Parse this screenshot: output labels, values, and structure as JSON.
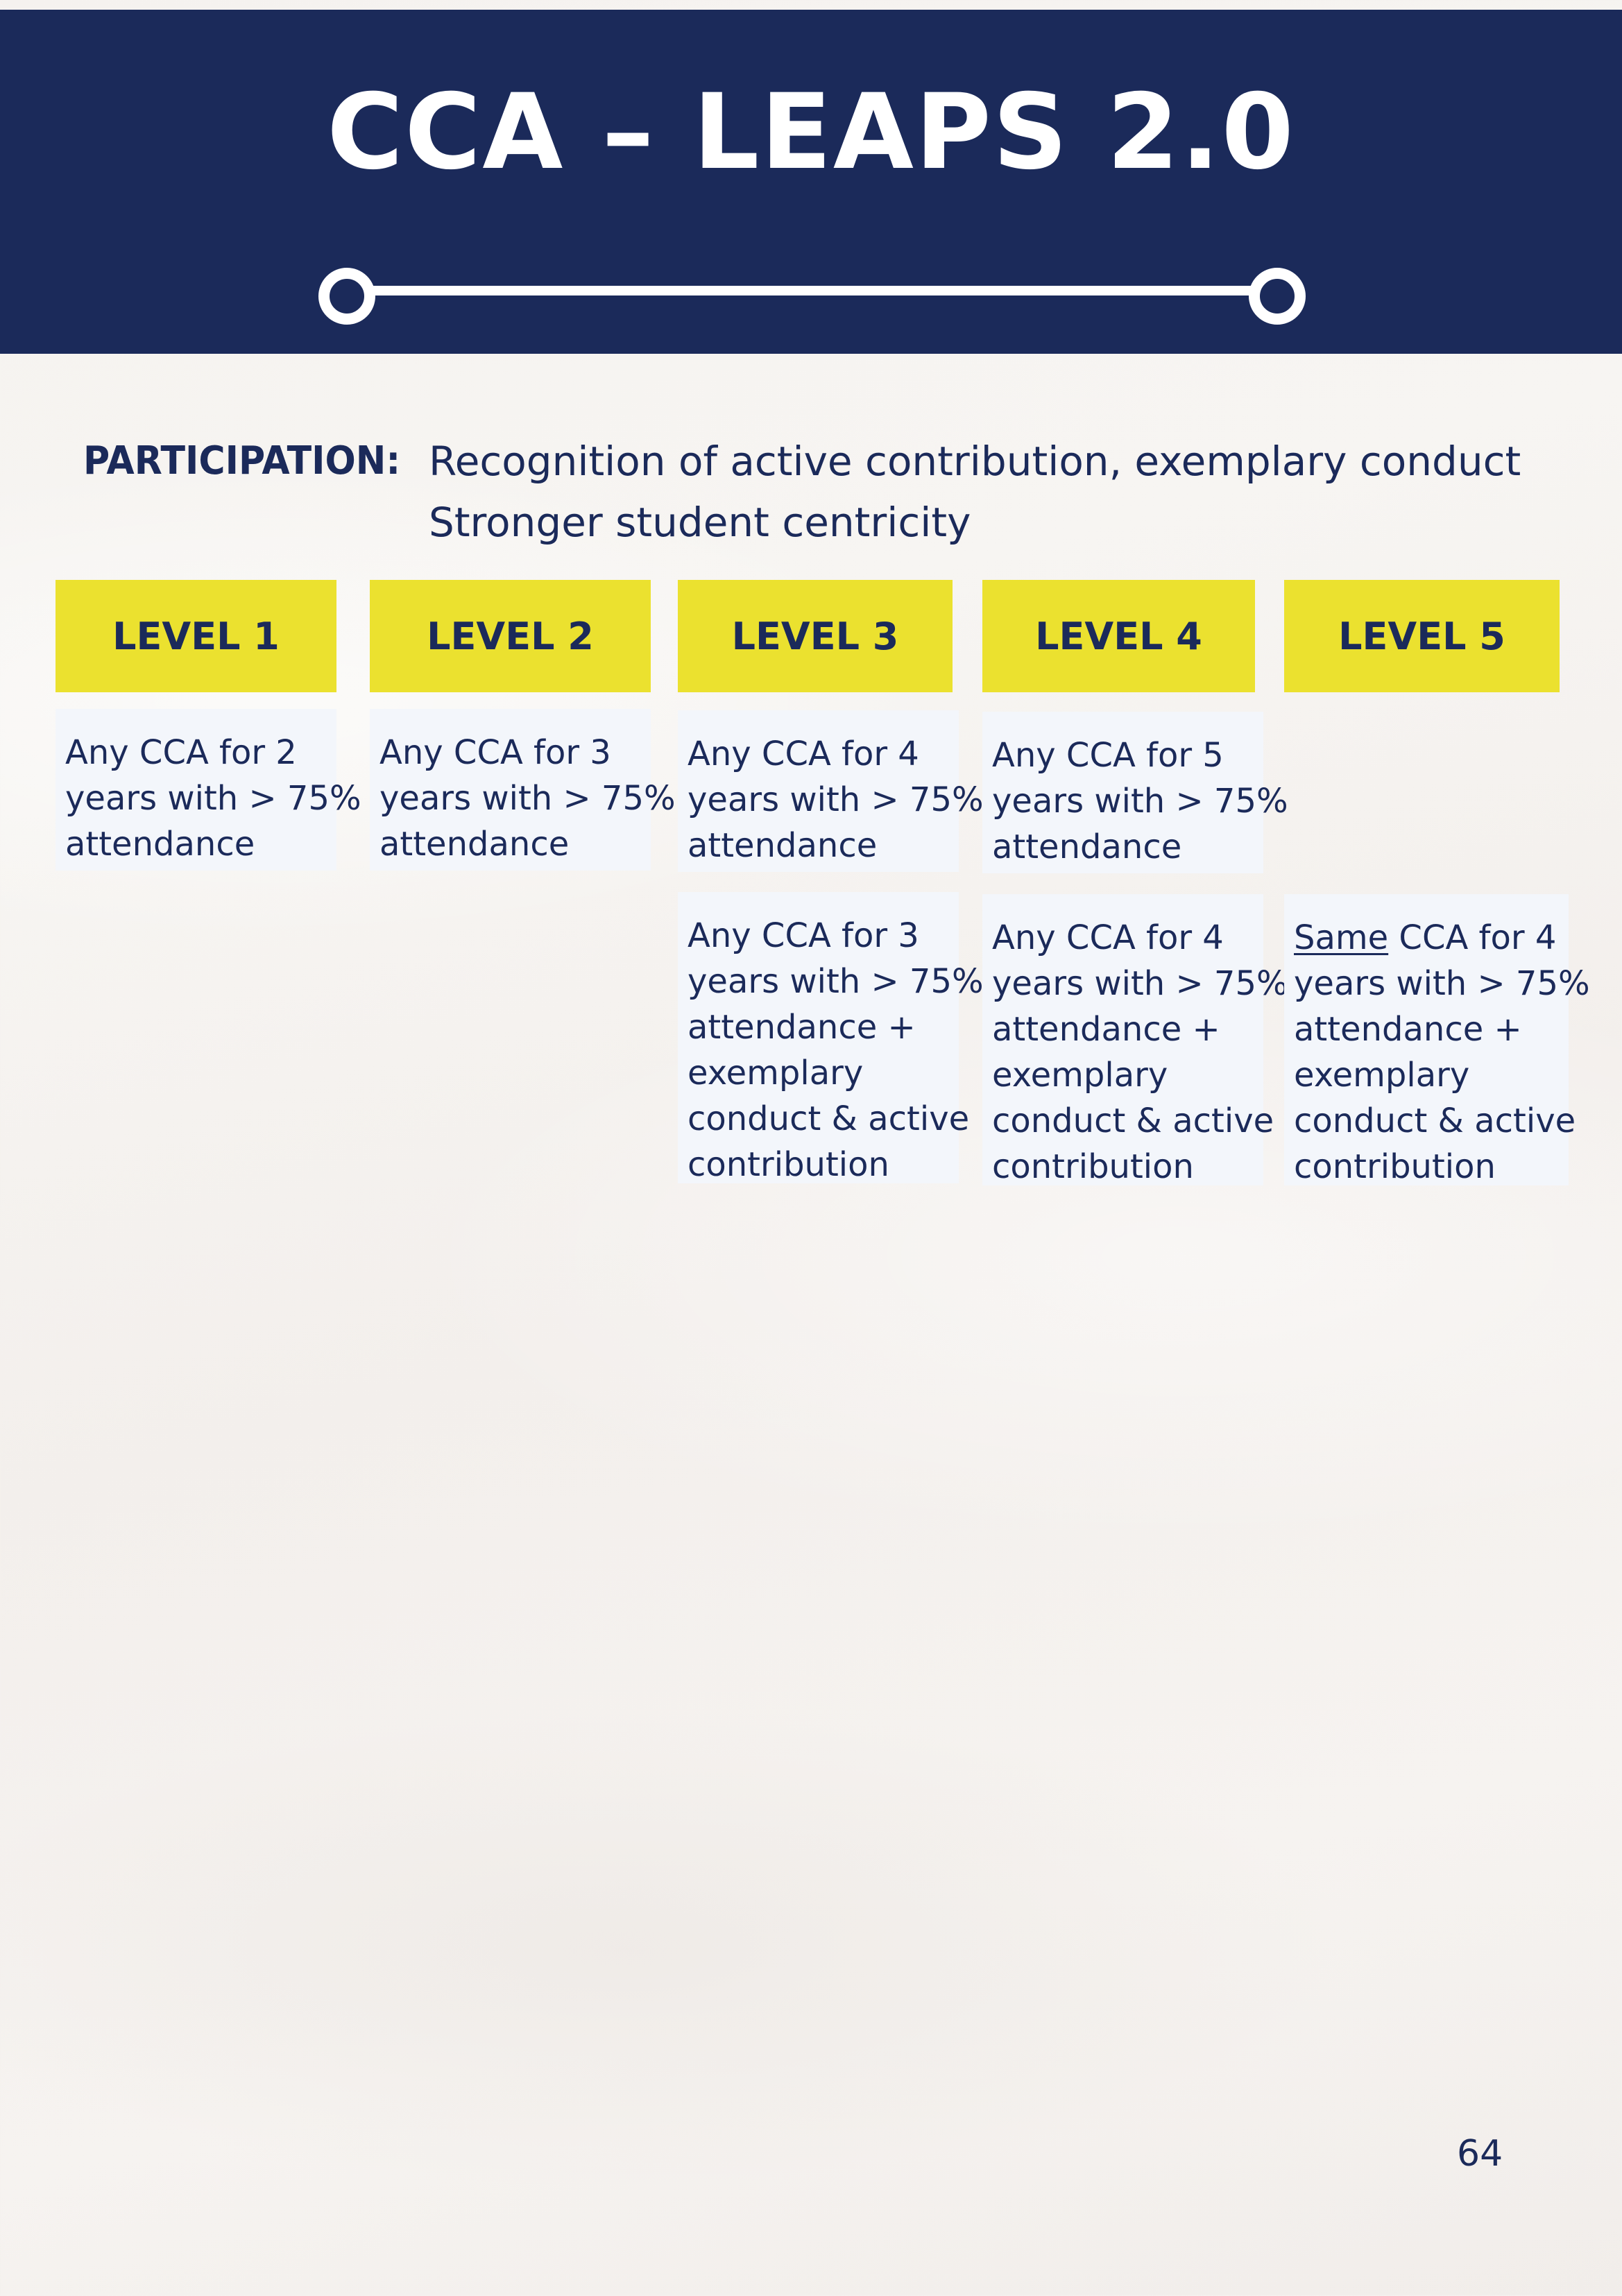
{
  "header": {
    "title": "CCA – LEAPS 2.0",
    "background_color": "#1b2a5a",
    "icon": "timeline-connector-icon"
  },
  "participation": {
    "label": "PARTICIPATION:",
    "line1": "Recognition of active contribution, exemplary conduct",
    "line2": "Stronger student centricity"
  },
  "levels": [
    {
      "label": "LEVEL 1"
    },
    {
      "label": "LEVEL 2"
    },
    {
      "label": "LEVEL 3"
    },
    {
      "label": "LEVEL 4"
    },
    {
      "label": "LEVEL 5"
    }
  ],
  "level_color": "#ebe12f",
  "row1": {
    "level1": [
      "Any CCA for 2",
      "years with > 75%",
      "attendance"
    ],
    "level2": [
      "Any CCA for 3",
      "years with > 75%",
      "attendance"
    ],
    "level3": [
      "Any CCA for 4",
      "years with > 75%",
      "attendance"
    ],
    "level4": [
      "Any CCA for 5",
      "years with > 75%",
      "attendance"
    ]
  },
  "row2": {
    "level3": [
      "Any CCA for 3",
      "years with > 75%",
      "attendance +",
      "exemplary",
      "conduct & active",
      "contribution"
    ],
    "level4": [
      "Any CCA for 4",
      "years with > 75%",
      "attendance +",
      "exemplary",
      "conduct & active",
      "contribution"
    ],
    "level5": {
      "emphasis": "Same",
      "first_line_rest": " CCA for 4",
      "lines": [
        "years with > 75%",
        "attendance +",
        "exemplary",
        "conduct & active",
        "contribution"
      ]
    }
  },
  "page_number": "64"
}
